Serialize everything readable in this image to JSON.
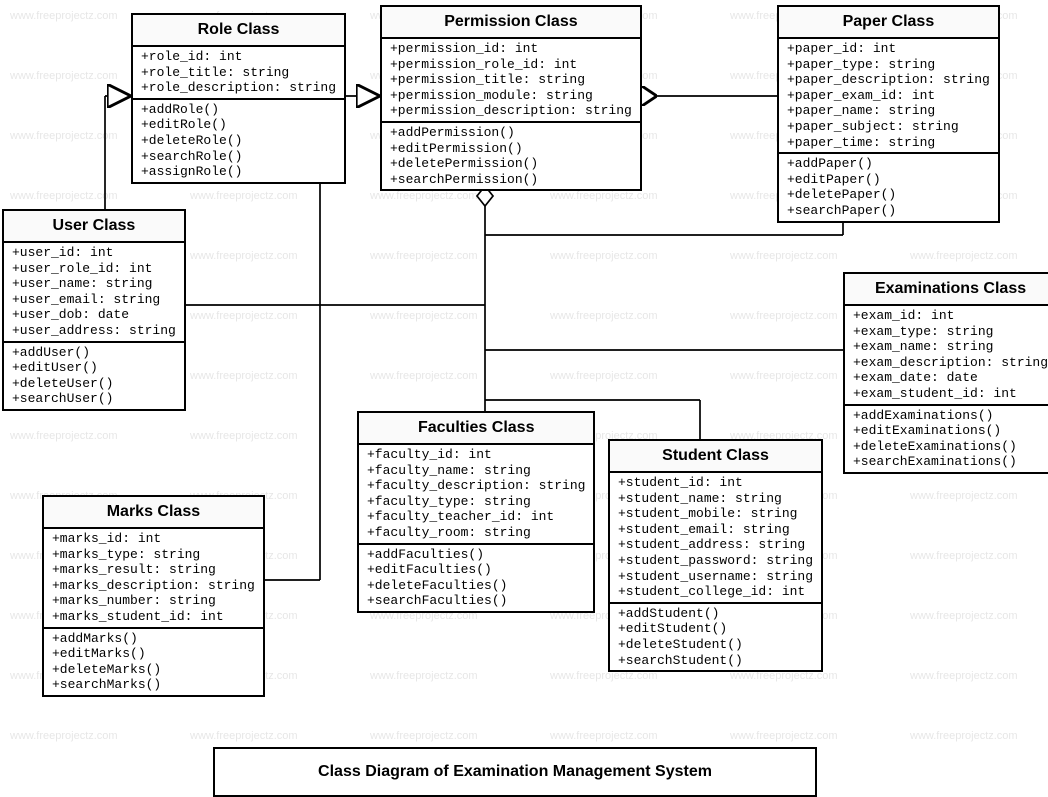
{
  "watermark_text": "www.freeprojectz.com",
  "footer_title": "Class Diagram of Examination Management System",
  "classes": {
    "role": {
      "title": "Role Class",
      "attrs": [
        "+role_id: int",
        "+role_title: string",
        "+role_description: string"
      ],
      "ops": [
        "+addRole()",
        "+editRole()",
        "+deleteRole()",
        "+searchRole()",
        "+assignRole()"
      ]
    },
    "permission": {
      "title": "Permission Class",
      "attrs": [
        "+permission_id: int",
        "+permission_role_id: int",
        "+permission_title: string",
        "+permission_module: string",
        "+permission_description: string"
      ],
      "ops": [
        "+addPermission()",
        "+editPermission()",
        "+deletePermission()",
        "+searchPermission()"
      ]
    },
    "paper": {
      "title": "Paper Class",
      "attrs": [
        "+paper_id: int",
        "+paper_type: string",
        "+paper_description: string",
        "+paper_exam_id: int",
        "+paper_name: string",
        "+paper_subject: string",
        "+paper_time: string"
      ],
      "ops": [
        "+addPaper()",
        "+editPaper()",
        "+deletePaper()",
        "+searchPaper()"
      ]
    },
    "user": {
      "title": "User Class",
      "attrs": [
        "+user_id: int",
        "+user_role_id: int",
        "+user_name: string",
        "+user_email: string",
        "+user_dob: date",
        "+user_address: string"
      ],
      "ops": [
        "+addUser()",
        "+editUser()",
        "+deleteUser()",
        "+searchUser()"
      ]
    },
    "examinations": {
      "title": "Examinations Class",
      "attrs": [
        "+exam_id: int",
        "+exam_type: string",
        "+exam_name: string",
        "+exam_description: string",
        "+exam_date: date",
        "+exam_student_id: int"
      ],
      "ops": [
        "+addExaminations()",
        "+editExaminations()",
        "+deleteExaminations()",
        "+searchExaminations()"
      ]
    },
    "faculties": {
      "title": "Faculties Class",
      "attrs": [
        "+faculty_id: int",
        "+faculty_name: string",
        "+faculty_description: string",
        "+faculty_type: string",
        "+faculty_teacher_id: int",
        "+faculty_room: string"
      ],
      "ops": [
        "+addFaculties()",
        "+editFaculties()",
        "+deleteFaculties()",
        "+searchFaculties()"
      ]
    },
    "student": {
      "title": "Student Class",
      "attrs": [
        "+student_id: int",
        "+student_name: string",
        "+student_mobile: string",
        "+student_email: string",
        "+student_address: string",
        "+student_password: string",
        "+student_username: string",
        "+student_college_id: int"
      ],
      "ops": [
        "+addStudent()",
        "+editStudent()",
        "+deleteStudent()",
        "+searchStudent()"
      ]
    },
    "marks": {
      "title": "Marks Class",
      "attrs": [
        "+marks_id: int",
        "+marks_type: string",
        "+marks_result: string",
        "+marks_description: string",
        "+marks_number: string",
        "+marks_student_id: int"
      ],
      "ops": [
        "+addMarks()",
        "+editMarks()",
        "+deleteMarks()",
        "+searchMarks()"
      ]
    }
  }
}
